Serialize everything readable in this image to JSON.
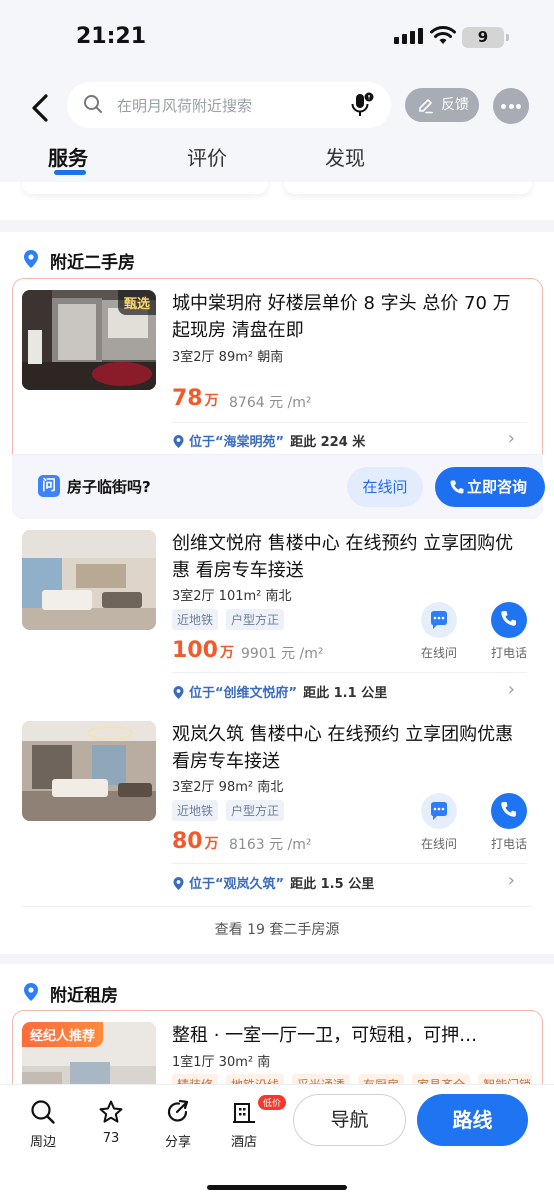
{
  "status": {
    "time": "21:21",
    "battery": "9"
  },
  "header": {
    "search_placeholder": "在明月风荷附近搜索",
    "feedback_label": "反馈",
    "tabs": [
      {
        "label": "服务"
      },
      {
        "label": "评价"
      },
      {
        "label": "发现"
      }
    ]
  },
  "secondhand": {
    "section_title": "附近二手房",
    "listings": [
      {
        "badge": "甄选",
        "title": "城中棠玥府 好楼层单价 8 字头 总价 70 万起现房 清盘在即",
        "spec": "3室2厅 89m² 朝南",
        "price": "78",
        "price_unit": "万",
        "unit_price": "8764 元 /m²",
        "location_prefix": "位于",
        "location_name": "“海棠明苑”",
        "distance": "距此 224 米",
        "ask_text": "房子临街吗?",
        "btn_online": "在线问",
        "btn_consult": "立即咨询"
      },
      {
        "title": "创维文悦府 售楼中心 在线预约 立享团购优惠 看房专车接送",
        "spec": "3室2厅 101m² 南北",
        "tags": [
          "近地铁",
          "户型方正"
        ],
        "price": "100",
        "price_unit": "万",
        "unit_price": "9901 元 /m²",
        "location_prefix": "位于",
        "location_name": "“创维文悦府”",
        "distance": "距此 1.1 公里",
        "action_chat": "在线问",
        "action_call": "打电话"
      },
      {
        "title": "观岚久筑 售楼中心 在线预约 立享团购优惠 看房专车接送",
        "spec": "3室2厅 98m² 南北",
        "tags": [
          "近地铁",
          "户型方正"
        ],
        "price": "80",
        "price_unit": "万",
        "unit_price": "8163 元 /m²",
        "location_prefix": "位于",
        "location_name": "“观岚久筑”",
        "distance": "距此 1.5 公里",
        "action_chat": "在线问",
        "action_call": "打电话"
      }
    ],
    "view_more": "查看 19 套二手房源"
  },
  "rental": {
    "section_title": "附近租房",
    "badge": "经纪人推荐",
    "title": "整租 · 一室一厅一卫，可短租，可押…",
    "spec": "1室1厅 30m² 南",
    "tags": [
      "精装修",
      "地铁沿线",
      "采光通透",
      "有厨房",
      "家具齐全",
      "智能门锁"
    ]
  },
  "bottom_bar": {
    "items": [
      {
        "label": "周边"
      },
      {
        "label": "73"
      },
      {
        "label": "分享"
      },
      {
        "label": "酒店"
      }
    ],
    "hotel_badge": "低价",
    "nav_label": "导航",
    "route_label": "路线"
  },
  "colors": {
    "accent": "#1f6ff1",
    "price": "#f25a2c",
    "highlight_border": "#f6b9ab"
  }
}
